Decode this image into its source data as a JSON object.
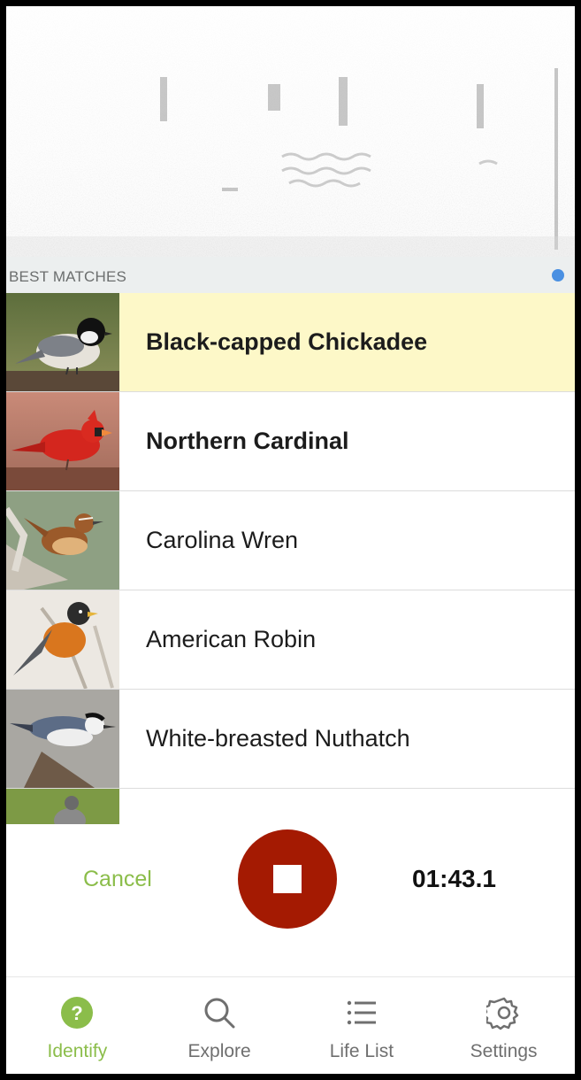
{
  "matches": {
    "header": "BEST MATCHES",
    "items": [
      {
        "name": "Black-capped Chickadee",
        "bold": true,
        "highlight": true
      },
      {
        "name": "Northern Cardinal",
        "bold": true,
        "highlight": false
      },
      {
        "name": "Carolina Wren",
        "bold": false,
        "highlight": false
      },
      {
        "name": "American Robin",
        "bold": false,
        "highlight": false
      },
      {
        "name": "White-breasted Nuthatch",
        "bold": false,
        "highlight": false
      }
    ]
  },
  "controls": {
    "cancel_label": "Cancel",
    "timer": "01:43.1"
  },
  "nav": {
    "items": [
      {
        "label": "Identify",
        "icon": "question-circle-icon",
        "active": true
      },
      {
        "label": "Explore",
        "icon": "search-icon",
        "active": false
      },
      {
        "label": "Life List",
        "icon": "list-icon",
        "active": false
      },
      {
        "label": "Settings",
        "icon": "gear-icon",
        "active": false
      }
    ]
  },
  "colors": {
    "accent_green": "#8bbd4a",
    "stop_red": "#a41a02",
    "highlight_yellow": "#fdf8c8",
    "indicator_blue": "#4a90e2"
  }
}
